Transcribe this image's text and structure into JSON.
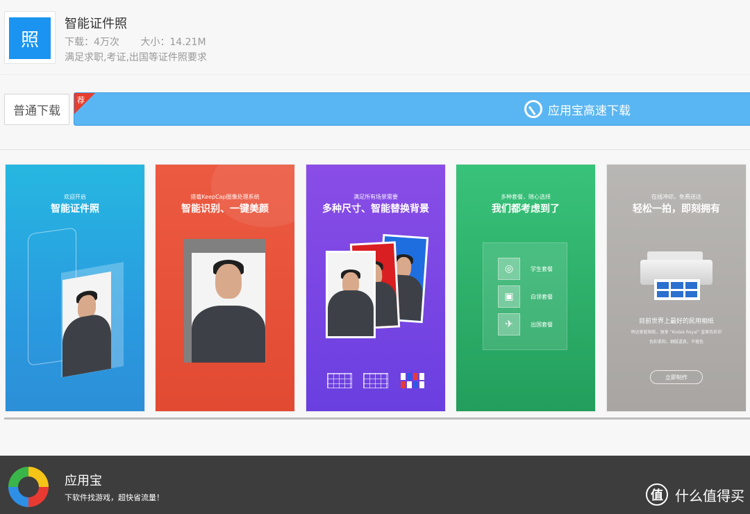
{
  "app": {
    "icon_char": "照",
    "title": "智能证件照",
    "downloads": "下载：4万次",
    "size": "大小：14.21M",
    "description": "满足求职,考证,出国等证件照要求"
  },
  "download": {
    "normal_label": "普通下载",
    "badge": "荐",
    "fast_label": "应用宝高速下载"
  },
  "screens": [
    {
      "small": "欢迎开启",
      "big": "智能证件照"
    },
    {
      "small": "搭载KeepCap图像处理系统",
      "big": "智能识别、一键美颜"
    },
    {
      "small": "满足所有场景需要",
      "big": "多种尺寸、智能替换背景"
    },
    {
      "small": "多种套餐，随心选择",
      "big": "我们都考虑到了",
      "packages": [
        "学生套餐",
        "白领套餐",
        "出国套餐"
      ]
    },
    {
      "small": "在线冲印，免费送达",
      "big": "轻松一拍，即刻拥有",
      "line1": "目前世界上最好的民用相纸",
      "line2": "柯达家庭相纸，独享 “Kodak Royal” 皇家色彩印",
      "line3": "色彩柔和，细腻逼真，不褪色",
      "button": "立即制作"
    }
  ],
  "footer": {
    "title": "应用宝",
    "subtitle": "下软件找游戏，超快省流量！",
    "watermark_icon": "值",
    "watermark_text": "什么值得买"
  },
  "colors": {
    "accent": "#1a94f0",
    "fast_button": "#5ab6f2",
    "badge": "#e83d2e",
    "footer_bg": "#3d3d3d"
  }
}
